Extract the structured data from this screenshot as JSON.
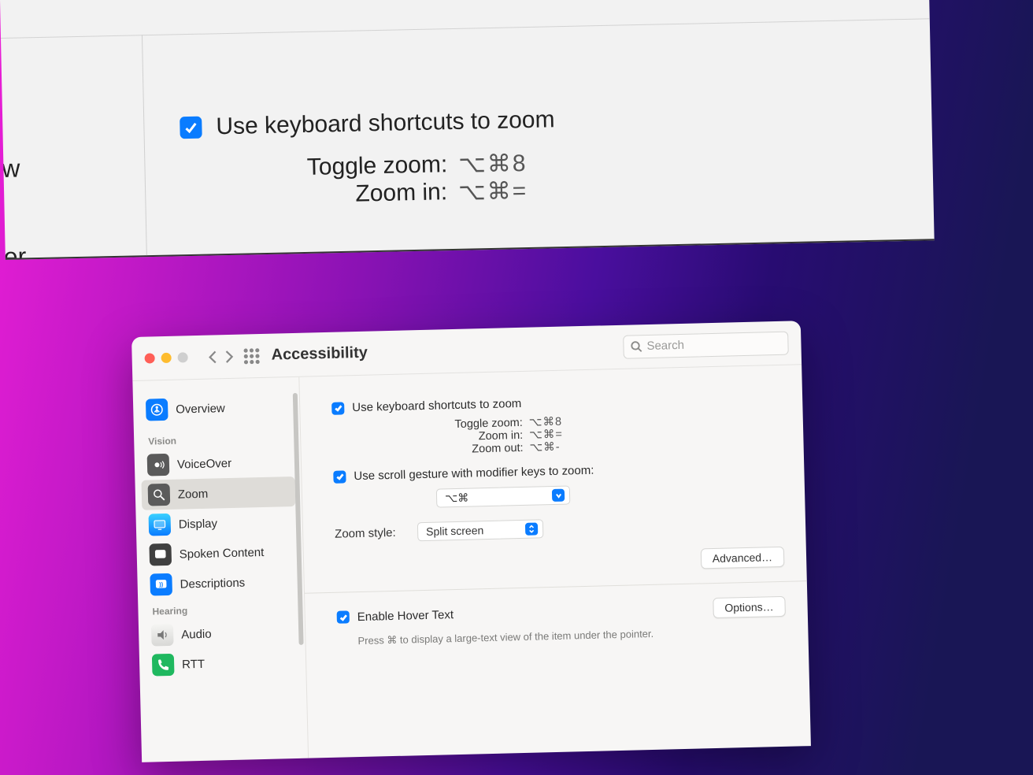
{
  "top_preview": {
    "checkbox_label": "Use keyboard shortcuts to zoom",
    "checkbox_checked": true,
    "shortcuts": [
      {
        "label": "Toggle zoom:",
        "keys": "⌥⌘8"
      },
      {
        "label": "Zoom in:",
        "keys": "⌥⌘="
      }
    ],
    "left_frag_top": "ew",
    "left_frag_bottom": "ver"
  },
  "toolbar": {
    "title": "Accessibility",
    "search_placeholder": "Search"
  },
  "sidebar": {
    "overview_label": "Overview",
    "sections": [
      {
        "title": "Vision",
        "items": [
          {
            "id": "voiceover",
            "label": "VoiceOver",
            "icon": "voiceover-icon"
          },
          {
            "id": "zoom",
            "label": "Zoom",
            "icon": "zoom-icon",
            "selected": true
          },
          {
            "id": "display",
            "label": "Display",
            "icon": "display-icon"
          },
          {
            "id": "spoken",
            "label": "Spoken Content",
            "icon": "spoken-content-icon"
          },
          {
            "id": "descriptions",
            "label": "Descriptions",
            "icon": "descriptions-icon"
          }
        ]
      },
      {
        "title": "Hearing",
        "items": [
          {
            "id": "audio",
            "label": "Audio",
            "icon": "audio-icon"
          },
          {
            "id": "rtt",
            "label": "RTT",
            "icon": "rtt-icon"
          }
        ]
      }
    ]
  },
  "content": {
    "use_shortcuts_label": "Use keyboard shortcuts to zoom",
    "use_shortcuts_checked": true,
    "shortcuts": [
      {
        "label": "Toggle zoom:",
        "keys": "⌥⌘8"
      },
      {
        "label": "Zoom in:",
        "keys": "⌥⌘="
      },
      {
        "label": "Zoom out:",
        "keys": "⌥⌘-"
      }
    ],
    "use_scroll_label": "Use scroll gesture with modifier keys to zoom:",
    "use_scroll_checked": true,
    "modifier_value": "⌥⌘",
    "zoom_style_label": "Zoom style:",
    "zoom_style_value": "Split screen",
    "advanced_label": "Advanced…",
    "hover_text_checked": true,
    "hover_text_label": "Enable Hover Text",
    "hover_options_label": "Options…",
    "hover_help": "Press ⌘ to display a large-text view of the item under the pointer."
  }
}
